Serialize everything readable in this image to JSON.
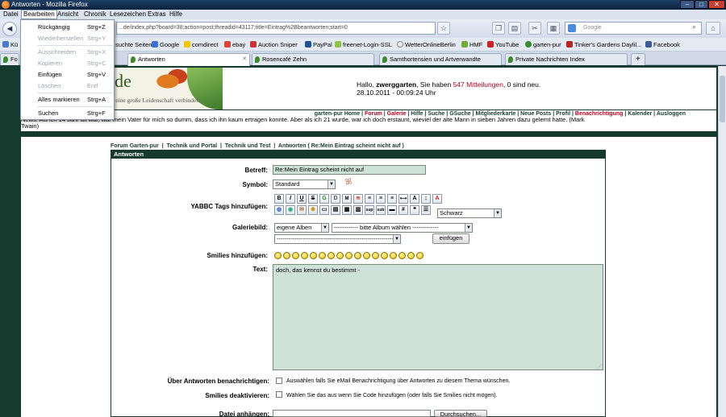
{
  "window": {
    "title": "Antworten - Mozilla Firefox"
  },
  "menubar": {
    "items": [
      "Datei",
      "Bearbeiten",
      "Ansicht",
      "Chronik",
      "Lesezeichen",
      "Extras",
      "Hilfe"
    ]
  },
  "edit_menu": {
    "items": [
      {
        "label": "Rückgängig",
        "shortcut": "Strg+Z",
        "enabled": true
      },
      {
        "label": "Wiederherstellen",
        "shortcut": "Strg+Y",
        "enabled": false
      },
      {
        "label": "Ausschneiden",
        "shortcut": "Strg+X",
        "enabled": false
      },
      {
        "label": "Kopieren",
        "shortcut": "Strg+C",
        "enabled": false
      },
      {
        "label": "Einfügen",
        "shortcut": "Strg+V",
        "enabled": true
      },
      {
        "label": "Löschen",
        "shortcut": "Entf",
        "enabled": false
      },
      {
        "label": "Alles markieren",
        "shortcut": "Strg+A",
        "enabled": true
      },
      {
        "label": "Suchen",
        "shortcut": "Strg+F",
        "enabled": true
      }
    ]
  },
  "navbar": {
    "url": "...de/index.php?board=38;action=post;threadid=43117;title=Eintrag%2Bbeantworten;start=0",
    "search_placeholder": "Google"
  },
  "bookmarks": {
    "items": [
      "Kü",
      "suchte Seiten",
      "Google",
      "comdirect",
      "ebay",
      "Auction Sniper",
      "PayPal",
      "freenet-Login-SSL",
      "WetterOnlineBerlin",
      "HMF",
      "YouTube",
      "garten-pur",
      "Tinker's Gardens Daylil...",
      "Facebook"
    ]
  },
  "tabs": [
    {
      "label": "Fo",
      "active": false
    },
    {
      "label": "Antworten",
      "active": true
    },
    {
      "label": "Rosencafé Zehn",
      "active": false
    },
    {
      "label": "Samthortensien und Artverwandte",
      "active": false
    },
    {
      "label": "Private Nachrichten Index",
      "active": false
    }
  ],
  "header": {
    "logo_text": "de",
    "slogan": "e eine große Leidenschaft verbindet.",
    "greeting_prefix": "Hallo, ",
    "username": "zwerggarten",
    "greeting_mid": ", Sie haben ",
    "messages_link": "547 Mitteilungen",
    "greeting_suffix": ", 0 sind neu.",
    "datetime": "28.10.2011 - 00:09:24 Uhr"
  },
  "forum_nav": {
    "items": [
      "garten-pur Home",
      "Forum",
      "Galerie",
      "Hilfe",
      "Suche",
      "GSuche",
      "Mitgliederkarte",
      "Neue Posts",
      "Profil",
      "Benachrichtigung",
      "Kalender",
      "Ausloggen"
    ]
  },
  "quote": {
    "line1": "News: Als ich 14 Jahr alt war, war mein Vater für mich so dumm, dass ich ihn kaum ertragen konnte. Aber als ich 21 wurde, war ich doch erstaunt, wieviel der alte Mann in sieben Jahren dazu gelernt hatte. (Mark",
    "line2": "Twain)"
  },
  "breadcrumb": {
    "items": [
      "Forum Garten-pur",
      "Technik und Portal",
      "Technik und Test",
      "Antworten ( Re:Mein Eintrag scheint nicht auf )"
    ]
  },
  "form": {
    "title": "Antworten",
    "betreff_label": "Betreff:",
    "betreff_value": "Re:Mein Eintrag scheint nicht auf",
    "symbol_label": "Symbol:",
    "symbol_value": "Standard",
    "yabbc_label": "YABBC Tags hinzufügen:",
    "color_value": "Schwarz",
    "galerie_label": "Galeriebild:",
    "album_value": "eigene Alben",
    "album_choose": "------------ bitte Album wählen -------------",
    "image_value": "----------------------------------------------------------------",
    "insert_button": "einfügen",
    "smilies_label": "Smilies hinzufügen:",
    "text_label": "Text:",
    "text_value": "doch, das kennst du bestimmt -",
    "notify_label": "Über Antworten benachrichtigen:",
    "notify_note": "Auswählen falls Sie eMail Benachrichtigung über Antworten zu diesem Thema wünschen.",
    "disable_smilies_label": "Smilies deaktivieren:",
    "disable_smilies_note": "Wählen Sie das aus wenn Sie Code hinzufügen (oder falls Sie Smilies nicht mögen).",
    "attach_label": "Datei anhängen:",
    "browse_button": "Durchsuchen..."
  }
}
